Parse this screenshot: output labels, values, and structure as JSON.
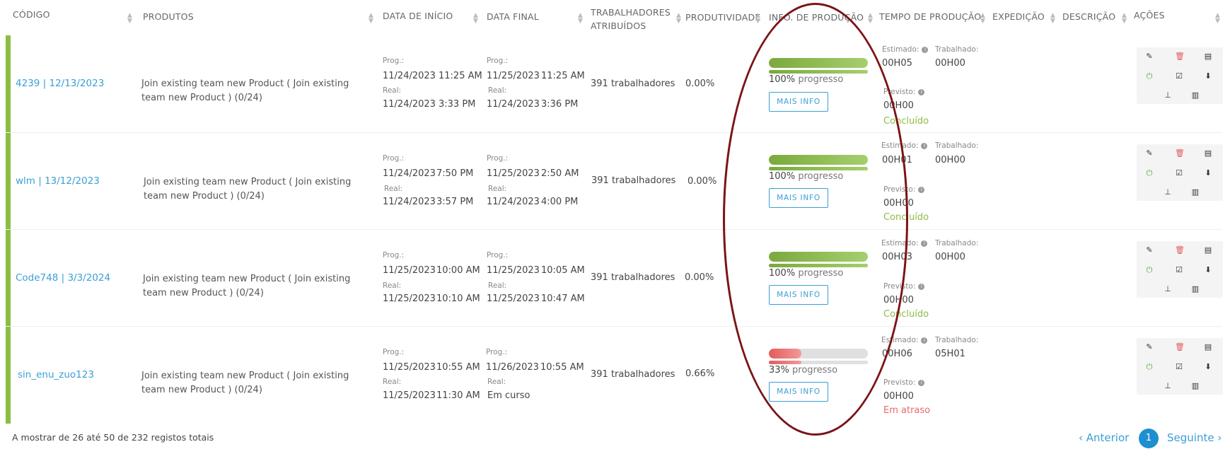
{
  "headers": {
    "codigo": "CÓDIGO",
    "produtos": "PRODUTOS",
    "data_inicio": "DATA DE INÍCIO",
    "data_final": "DATA FINAL",
    "trab_1": "TRABALHADORES",
    "trab_2": "ATRIBUÍDOS",
    "produtividade": "PRODUTIVIDADE",
    "info_producao": "INFO. DE PRODUÇÃO",
    "tempo_producao": "TEMPO DE PRODUÇÃO",
    "expedicao": "EXPEDIÇÃO",
    "descricao": "DESCRIÇÃO",
    "acoes": "AÇÕES"
  },
  "labels": {
    "prog": "Prog.:",
    "real": "Real:",
    "estimado": "Estimado:",
    "trabalhado": "Trabalhado:",
    "previsto": "Previsto:",
    "mais_info": "MAIS INFO",
    "progresso": "progresso"
  },
  "colors": {
    "accent": "#3a9fd6",
    "ok": "#8bbd45",
    "late": "#e86a6a",
    "annotation": "#7a1416"
  },
  "rows": [
    {
      "code": "4239 | 12/13/2023",
      "product": "Join existing team new Product ( Join existing team new Product ) (0/24)",
      "start_prog_date": "11/24/2023",
      "start_prog_time": "11:25 AM",
      "start_real_date": "11/24/2023",
      "start_real_time": "3:33 PM",
      "end_prog_date": "11/25/2023",
      "end_prog_time": "11:25 AM",
      "end_real_date": "11/24/2023",
      "end_real_time": "3:36 PM",
      "workers": "391 trabalhadores",
      "productivity": "0.00%",
      "progress": 100,
      "progress_label": "100%",
      "estimado": "00H05",
      "trabalhado": "00H00",
      "previsto": "00H00",
      "status": "Concluído",
      "status_type": "ok"
    },
    {
      "code": "wlm | 13/12/2023",
      "product": "Join existing team new Product ( Join existing team new Product ) (0/24)",
      "start_prog_date": "11/24/2023",
      "start_prog_time": "7:50 PM",
      "start_real_date": "11/24/2023",
      "start_real_time": "3:57 PM",
      "end_prog_date": "11/25/2023",
      "end_prog_time": "2:50 AM",
      "end_real_date": "11/24/2023",
      "end_real_time": "4:00 PM",
      "workers": "391 trabalhadores",
      "productivity": "0.00%",
      "progress": 100,
      "progress_label": "100%",
      "estimado": "00H01",
      "trabalhado": "00H00",
      "previsto": "00H00",
      "status": "Concluído",
      "status_type": "ok"
    },
    {
      "code": "Code748 | 3/3/2024",
      "product": "Join existing team new Product ( Join existing team new Product ) (0/24)",
      "start_prog_date": "11/25/2023",
      "start_prog_time": "10:00 AM",
      "start_real_date": "11/25/2023",
      "start_real_time": "10:10 AM",
      "end_prog_date": "11/25/2023",
      "end_prog_time": "10:05 AM",
      "end_real_date": "11/25/2023",
      "end_real_time": "10:47 AM",
      "workers": "391 trabalhadores",
      "productivity": "0.00%",
      "progress": 100,
      "progress_label": "100%",
      "estimado": "00H03",
      "trabalhado": "00H00",
      "previsto": "00H00",
      "status": "Concluído",
      "status_type": "ok"
    },
    {
      "code": "sin_enu_zuo123",
      "product": "Join existing team new Product ( Join existing team new Product ) (0/24)",
      "start_prog_date": "11/25/2023",
      "start_prog_time": "10:55 AM",
      "start_real_date": "11/25/2023",
      "start_real_time": "11:30 AM",
      "end_prog_date": "11/26/2023",
      "end_prog_time": "10:55 AM",
      "end_real_date": "Em curso",
      "end_real_time": "",
      "workers": "391 trabalhadores",
      "productivity": "0.66%",
      "progress": 33,
      "progress_label": "33%",
      "estimado": "00H06",
      "trabalhado": "05H01",
      "previsto": "00H00",
      "status": "Em atraso",
      "status_type": "late"
    }
  ],
  "footer": {
    "summary": "A mostrar de 26 até 50 de 232 registos totais",
    "prev": "‹ Anterior",
    "page": "1",
    "next": "Seguinte ›"
  }
}
